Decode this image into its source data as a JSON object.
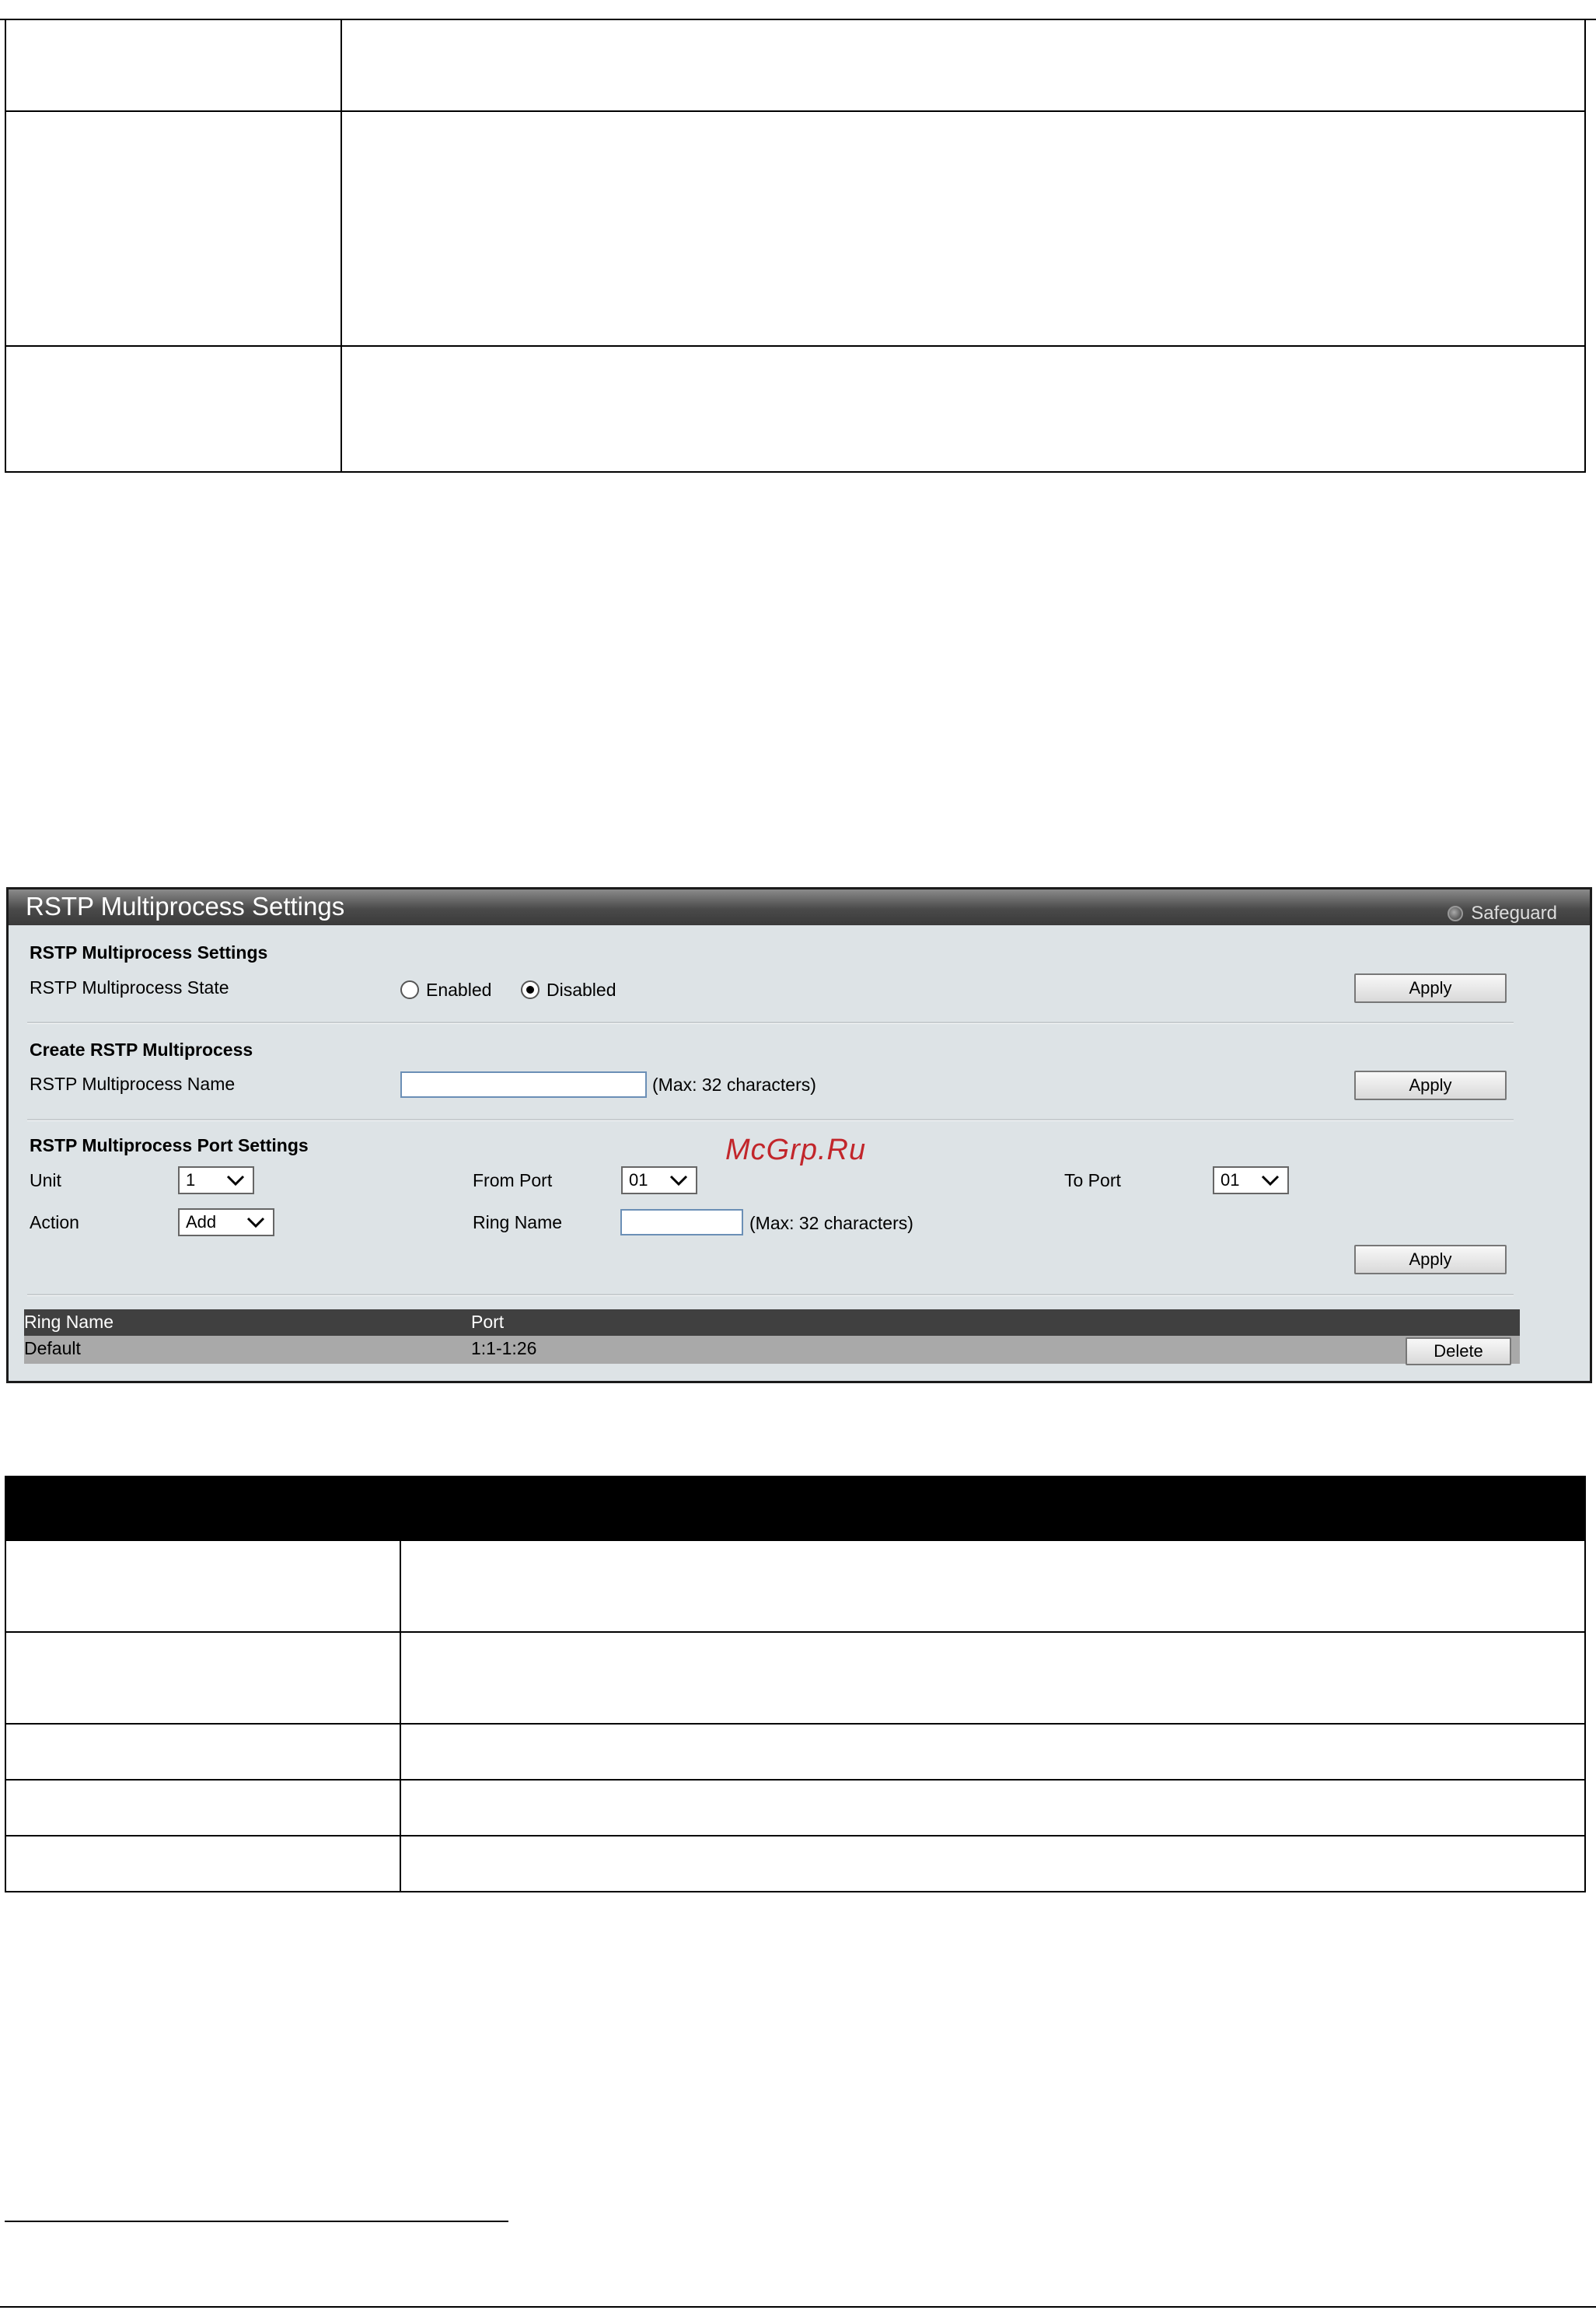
{
  "panel": {
    "title": "RSTP Multiprocess Settings",
    "safeguard_label": "Safeguard",
    "settings": {
      "section_title": "RSTP Multiprocess Settings",
      "state_label": "RSTP Multiprocess State",
      "enabled_label": "Enabled",
      "disabled_label": "Disabled",
      "selected": "Disabled",
      "apply_label": "Apply"
    },
    "create": {
      "section_title": "Create RSTP Multiprocess",
      "name_label": "RSTP Multiprocess Name",
      "name_value": "",
      "max_hint": "(Max: 32 characters)",
      "apply_label": "Apply"
    },
    "ports": {
      "section_title": "RSTP Multiprocess Port Settings",
      "unit_label": "Unit",
      "unit_value": "1",
      "from_port_label": "From Port",
      "from_port_value": "01",
      "to_port_label": "To Port",
      "to_port_value": "01",
      "action_label": "Action",
      "action_value": "Add",
      "ring_name_label": "Ring Name",
      "ring_name_value": "",
      "max_hint": "(Max: 32 characters)",
      "apply_label": "Apply"
    },
    "table": {
      "headers": [
        "Ring Name",
        "Port"
      ],
      "rows": [
        {
          "ring_name": "Default",
          "port": "1:1-1:26",
          "delete_label": "Delete"
        }
      ]
    }
  },
  "watermark": "McGrp.Ru"
}
